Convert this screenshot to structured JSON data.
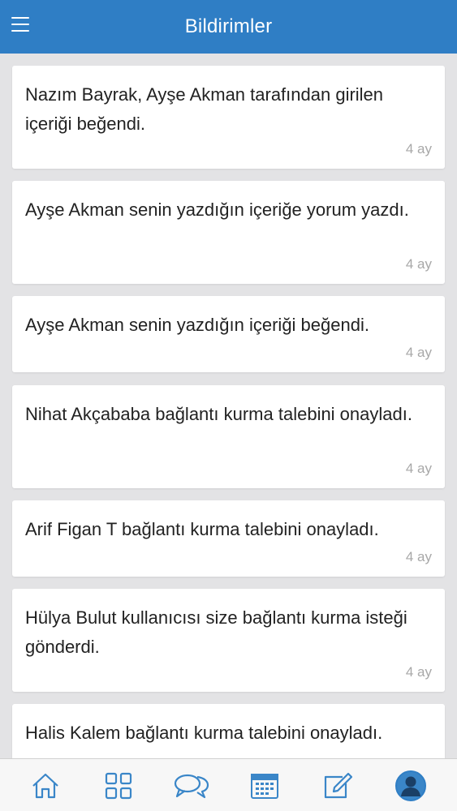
{
  "header": {
    "title": "Bildirimler",
    "menu_icon": "hamburger-menu-icon"
  },
  "colors": {
    "header_bg": "#2f7ec5",
    "tab_icon": "#3a86c8",
    "time_text": "#a8a8a8"
  },
  "notifications": [
    {
      "text": "Nazım Bayrak, Ayşe Akman tarafından girilen içeriği beğendi.",
      "time": "4 ay"
    },
    {
      "text": "Ayşe Akman senin yazdığın içeriğe yorum yazdı.",
      "time": "4 ay"
    },
    {
      "text": "Ayşe Akman senin yazdığın içeriği beğendi.",
      "time": "4 ay"
    },
    {
      "text": "Nihat Akçababa bağlantı kurma talebini onayladı.",
      "time": "4 ay"
    },
    {
      "text": "Arif Figan T bağlantı kurma talebini onayladı.",
      "time": "4 ay"
    },
    {
      "text": "Hülya Bulut kullanıcısı size bağlantı kurma isteği gönderdi.",
      "time": "4 ay"
    },
    {
      "text": "Halis Kalem bağlantı kurma talebini onayladı.",
      "time": ""
    }
  ],
  "tabbar": {
    "tabs": [
      {
        "icon": "home-icon"
      },
      {
        "icon": "grid-icon"
      },
      {
        "icon": "chat-bubbles-icon"
      },
      {
        "icon": "calendar-icon"
      },
      {
        "icon": "edit-icon"
      },
      {
        "icon": "profile-icon",
        "active": true
      }
    ]
  }
}
